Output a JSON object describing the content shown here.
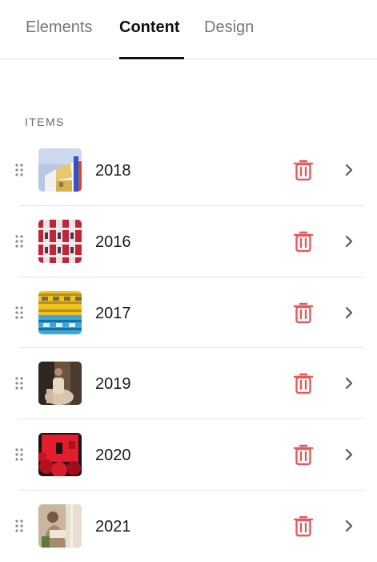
{
  "tabs": {
    "elements": "Elements",
    "content": "Content",
    "design": "Design"
  },
  "section": {
    "label": "ITEMS"
  },
  "colors": {
    "delete": "#e45b5b",
    "active_tab": "#111111",
    "inactive_tab": "#767676"
  },
  "items": [
    {
      "label": "2018",
      "thumbnail": "yellow-house-photo"
    },
    {
      "label": "2016",
      "thumbnail": "red-building-photo"
    },
    {
      "label": "2017",
      "thumbnail": "yellow-blue-building-photo"
    },
    {
      "label": "2019",
      "thumbnail": "woman-seated-photo"
    },
    {
      "label": "2020",
      "thumbnail": "red-house-photo"
    },
    {
      "label": "2021",
      "thumbnail": "man-reading-photo"
    }
  ]
}
